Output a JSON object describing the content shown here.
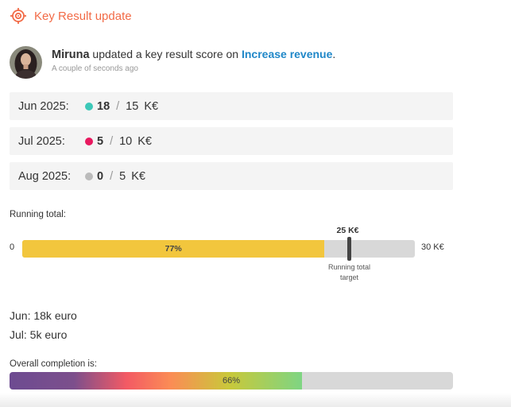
{
  "header": {
    "title": "Key Result update",
    "accent": "#f26b47"
  },
  "activity": {
    "user": "Miruna",
    "action": " updated a key result score on ",
    "link": "Increase revenue",
    "suffix": ".",
    "time": "A couple of seconds ago"
  },
  "periods": [
    {
      "label": "Jun 2025:",
      "value": "18",
      "target": "15",
      "unit": "K€",
      "status_color": "#3cc8b8"
    },
    {
      "label": "Jul 2025:",
      "value": "5",
      "target": "10",
      "unit": "K€",
      "status_color": "#e8195f"
    },
    {
      "label": "Aug 2025:",
      "value": "0",
      "target": "5",
      "unit": "K€",
      "status_color": "#bbbbbb"
    }
  ],
  "running_total": {
    "label": "Running total:",
    "min": "0",
    "max": "30 K€",
    "progress_label": "77%",
    "progress_fraction": 0.77,
    "marker_value": "25 K€",
    "marker_fraction": 0.833,
    "marker_caption_1": "Running total",
    "marker_caption_2": "target",
    "fill_color": "#f2c63d"
  },
  "notes": [
    "Jun: 18k euro",
    "Jul: 5k euro"
  ],
  "overall": {
    "label": "Overall completion is:",
    "progress_label": "66%",
    "progress_fraction": 0.66
  }
}
